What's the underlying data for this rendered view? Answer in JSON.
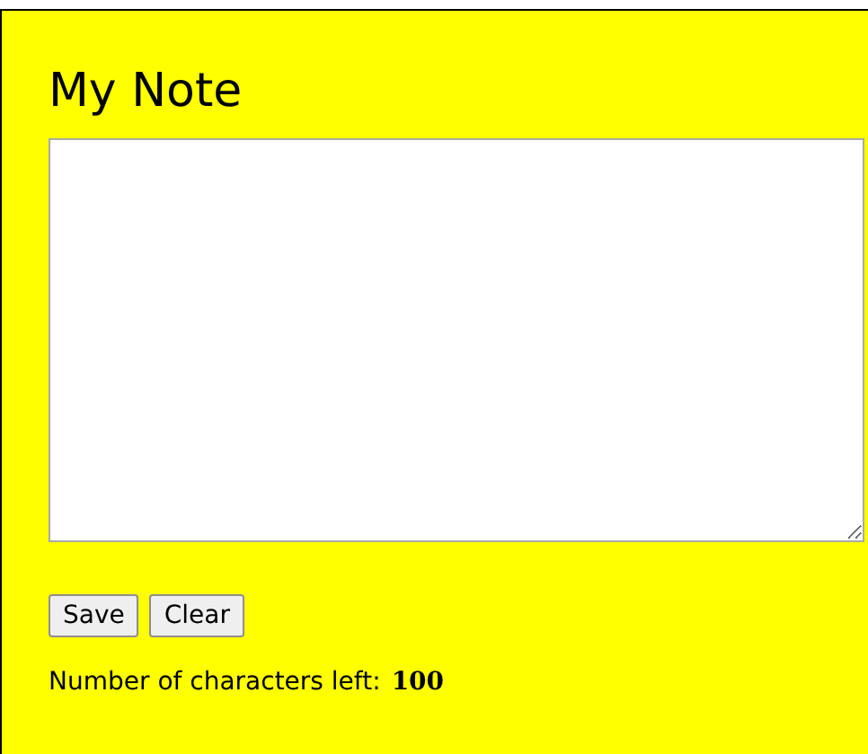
{
  "title": "My Note",
  "buttons": [
    {
      "label": "Save"
    },
    {
      "label": "Clear"
    }
  ],
  "counter": {
    "label": "Number of characters left:",
    "count": "100"
  }
}
